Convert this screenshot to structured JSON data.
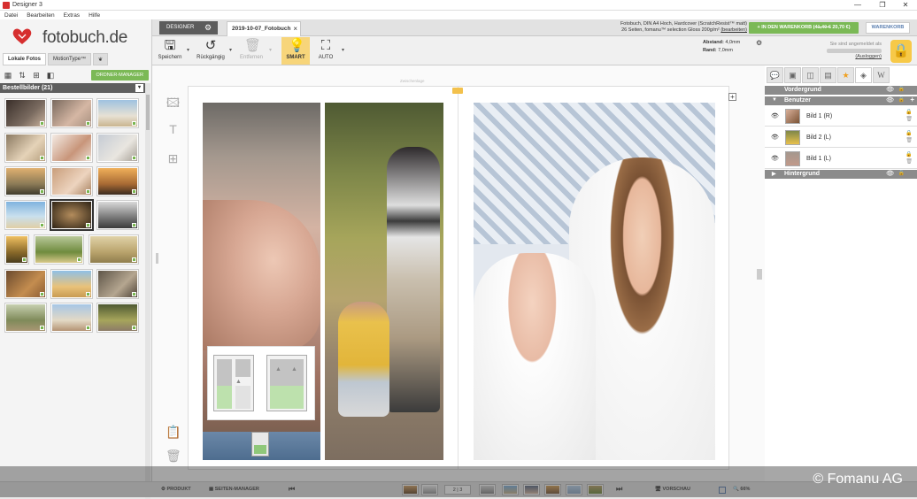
{
  "window": {
    "title": "Designer 3",
    "controls": [
      "—",
      "❐",
      "✕"
    ]
  },
  "menu": [
    "Datei",
    "Bearbeiten",
    "Extras",
    "Hilfe"
  ],
  "logo": {
    "text": "fotobuch.de"
  },
  "left_tabs": [
    "Lokale Fotos",
    "MotionType™"
  ],
  "ordner_manager": "ORDNER-MANAGER",
  "bestellbilder": "Bestellbilder (21)",
  "tabs": {
    "designer": "DESIGNER",
    "document": "2019-10-07_Fotobuch"
  },
  "product": {
    "line1": "Fotobuch, DIN A4 Hoch, Hardcover (ScratchResist™ matt)",
    "line2": "26 Seiten, fomanu™ selection Gloss 200g/m²",
    "edit_link": "(bearbeiten)"
  },
  "cart": {
    "label": "IN DEN WARENKORB",
    "old_price": "41,40 €",
    "new_price": "20,70 €",
    "warenkorb": "WARENKORB"
  },
  "toolbar": {
    "save": "Speichern",
    "undo": "Rückgängig",
    "remove": "Entfernen",
    "smart": "SMART",
    "auto": "AUTO",
    "abstand_label": "Abstand:",
    "abstand_value": "4,0mm",
    "rand_label": "Rand:",
    "rand_value": "7,0mm"
  },
  "login": {
    "status": "Sie sind angemeldet als",
    "logout": "(Ausloggen)"
  },
  "canvas": {
    "zwischenlage": "Zwischenlage"
  },
  "layers": {
    "vordergrund": "Vordergrund",
    "benutzer": "Benutzer",
    "items": [
      {
        "name": "Bild 1 (R)"
      },
      {
        "name": "Bild 2 (L)"
      },
      {
        "name": "Bild 1 (L)"
      }
    ],
    "hintergrund": "Hintergrund"
  },
  "bottom": {
    "produkt": "PRODUKT",
    "seiten_manager": "SEITEN-MANAGER",
    "page_a": "2",
    "page_b": "3",
    "vorschau": "VORSCHAU",
    "zoom": "66%"
  },
  "credit": "© Fomanu AG"
}
